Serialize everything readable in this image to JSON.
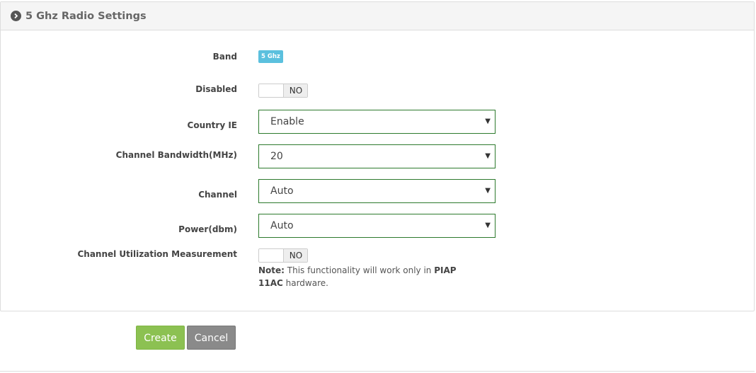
{
  "panel": {
    "title": "5 Ghz Radio Settings",
    "icon": "chevron-circle-right-icon"
  },
  "fields": {
    "band": {
      "label": "Band",
      "badge": "5 Ghz",
      "badge_color": "#5bc0de"
    },
    "disabled": {
      "label": "Disabled",
      "toggle_text": "NO"
    },
    "country_ie": {
      "label": "Country IE",
      "value": "Enable"
    },
    "channel_bandwidth": {
      "label": "Channel Bandwidth(MHz)",
      "value": "20"
    },
    "channel": {
      "label": "Channel",
      "value": "Auto"
    },
    "power": {
      "label": "Power(dbm)",
      "value": "Auto"
    },
    "channel_utilization": {
      "label": "Channel Utilization Measurement",
      "toggle_text": "NO",
      "note_prefix": "Note:",
      "note_text_1": " This functionality will work only in ",
      "note_highlight": "PIAP 11AC",
      "note_text_2": " hardware."
    }
  },
  "buttons": {
    "create": "Create",
    "cancel": "Cancel"
  },
  "colors": {
    "create_button": "#8cc152",
    "cancel_button": "#8a8a8a",
    "select_border": "#2d7a2d"
  }
}
